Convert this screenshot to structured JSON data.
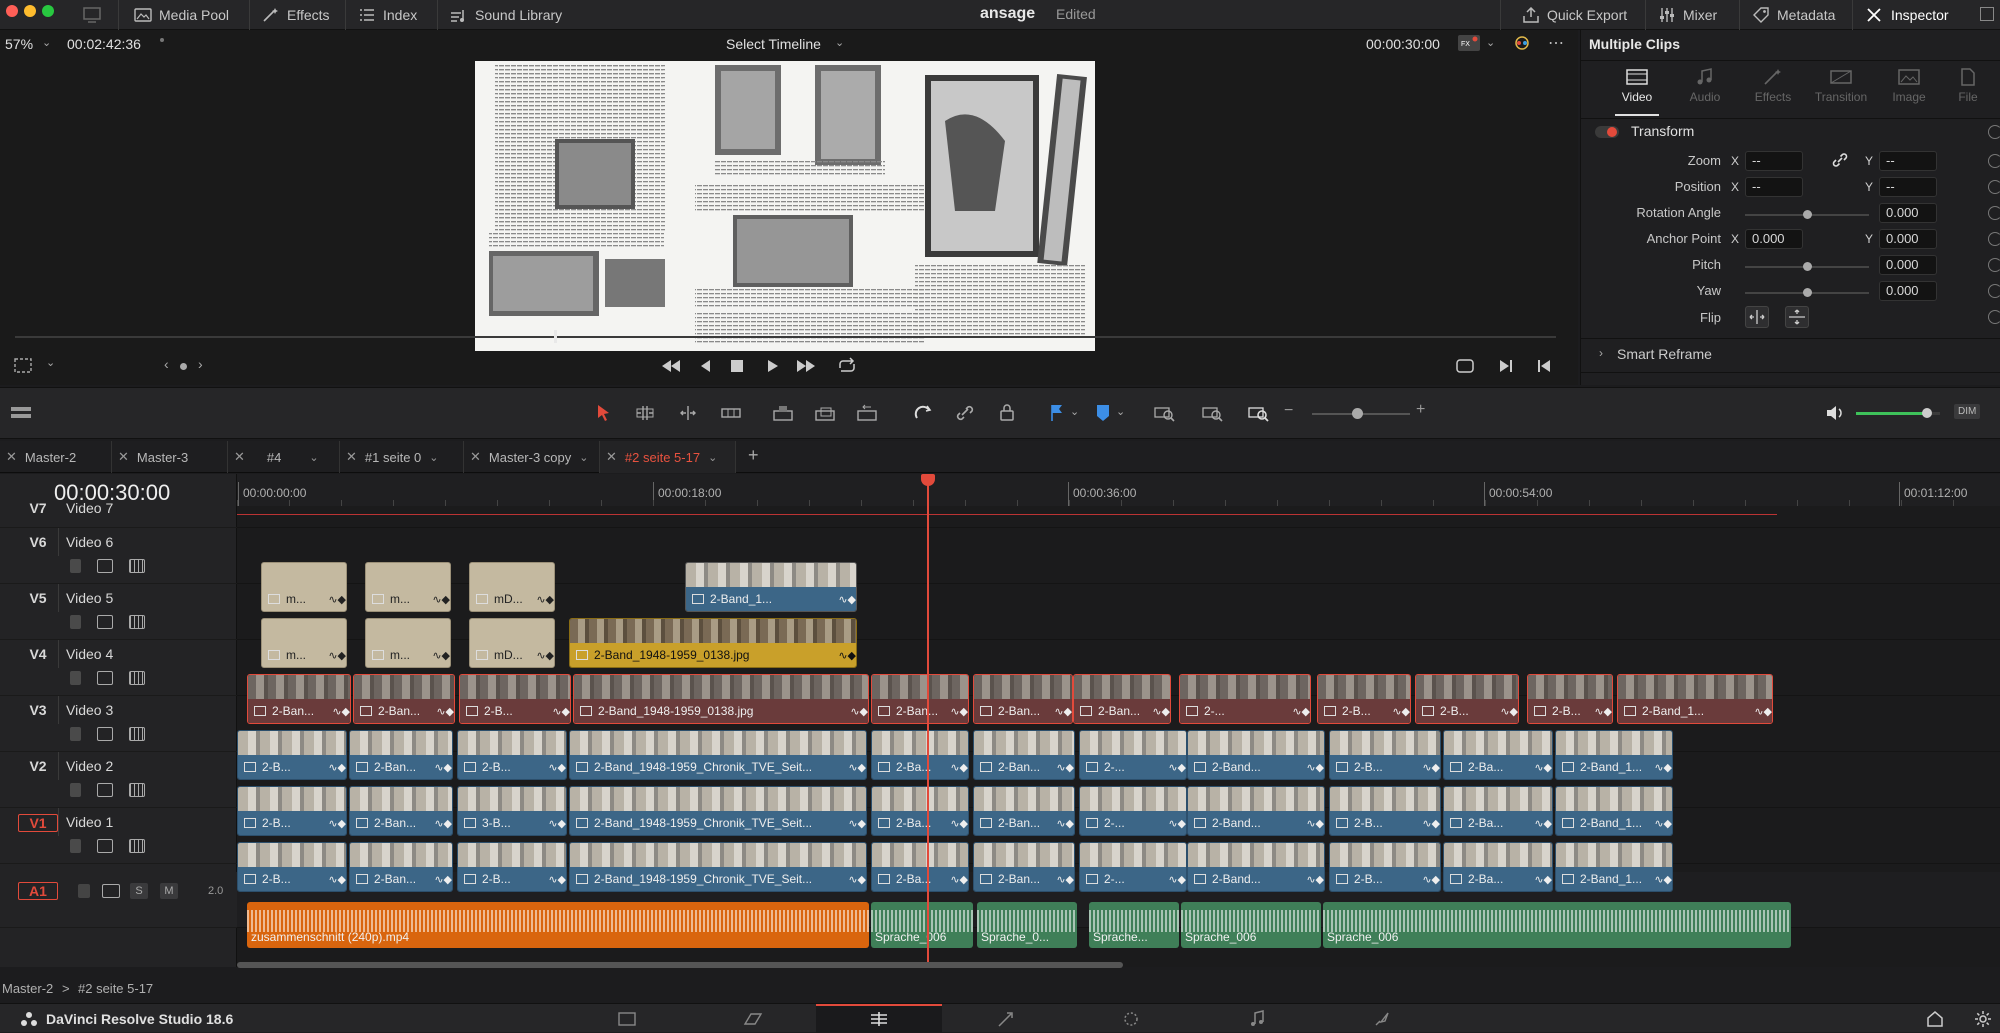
{
  "titlebar": {
    "media_pool": "Media Pool",
    "effects": "Effects",
    "index": "Index",
    "sound_library": "Sound Library",
    "project_name": "ansage",
    "project_status": "Edited",
    "quick_export": "Quick Export",
    "mixer": "Mixer",
    "metadata": "Metadata",
    "inspector": "Inspector"
  },
  "viewer": {
    "zoom": "57%",
    "source_timecode": "00:02:42:36",
    "timeline_select": "Select Timeline",
    "record_timecode": "00:00:30:00",
    "scrubber_position": 0.35
  },
  "inspector_panel": {
    "title": "Multiple Clips",
    "tabs": [
      "Video",
      "Audio",
      "Effects",
      "Transition",
      "Image",
      "File"
    ],
    "active_tab": "Video",
    "section": "Transform",
    "zoom_label": "Zoom",
    "zoom_x": "--",
    "zoom_y": "--",
    "position_label": "Position",
    "position_x": "--",
    "position_y": "--",
    "rotation_label": "Rotation Angle",
    "rotation_value": "0.000",
    "anchor_label": "Anchor Point",
    "anchor_x": "0.000",
    "anchor_y": "0.000",
    "pitch_label": "Pitch",
    "pitch_value": "0.000",
    "yaw_label": "Yaw",
    "yaw_value": "0.000",
    "flip_label": "Flip",
    "x_axis": "X",
    "y_axis": "Y",
    "smart_reframe": "Smart Reframe"
  },
  "toolbar": {
    "volume_level": 0.85,
    "dim": "DIM"
  },
  "timeline_tabs": [
    {
      "label": "Master-2"
    },
    {
      "label": "Master-3"
    },
    {
      "label": "#4"
    },
    {
      "label": "#1 seite 0"
    },
    {
      "label": "Master-3 copy"
    },
    {
      "label": "#2 seite 5-17"
    }
  ],
  "active_timeline_tab": "#2 seite 5-17",
  "timeline": {
    "timecode": "00:00:30:00",
    "ruler": [
      "00:00:00:00",
      "00:00:18:00",
      "00:00:36:00",
      "00:00:54:00",
      "00:01:12:00"
    ]
  },
  "tracks": [
    {
      "id": "V7",
      "name": "Video 7"
    },
    {
      "id": "V6",
      "name": "Video 6"
    },
    {
      "id": "V5",
      "name": "Video 5"
    },
    {
      "id": "V4",
      "name": "Video 4"
    },
    {
      "id": "V3",
      "name": "Video 3"
    },
    {
      "id": "V2",
      "name": "Video 2"
    },
    {
      "id": "V1",
      "name": "Video 1"
    },
    {
      "id": "A1",
      "name": "",
      "solo": "S",
      "mute": "M",
      "channels": "2.0"
    }
  ],
  "clip_labels": {
    "m1": "m...",
    "m2": "m...",
    "md": "mD...",
    "band1": "2-Band_1...",
    "band_jpg": "2-Band_1948-1959_0138.jpg",
    "ban": "2-Ban...",
    "b": "2-B...",
    "ba": "2-Ba...",
    "b2": "2-...",
    "band": "2-Band...",
    "chronik": "2-Band_1948-1959_Chronik_TVE_Seit...",
    "b3": "3-B...",
    "band1b": "2-Band_1...",
    "zusammen": "zusammenschnitt (240p).mp4",
    "sprache_006a": "Sprache_006",
    "sprache_0": "Sprache_0...",
    "sprache_dots": "Sprache...",
    "sprache_006": "Sprache_006"
  },
  "breadcrumb": {
    "root": "Master-2",
    "current": "#2 seite 5-17"
  },
  "app": {
    "name": "DaVinci Resolve Studio 18.6",
    "active_page": "Edit"
  }
}
